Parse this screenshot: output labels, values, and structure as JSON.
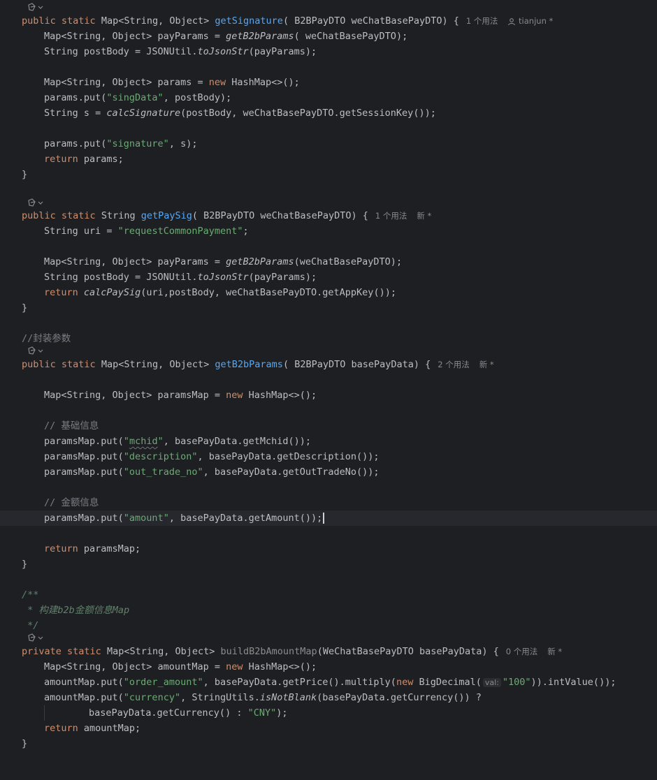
{
  "editor": {
    "methods": [
      {
        "signature": {
          "mods": "public static",
          "ret": "Map<String, Object>",
          "name": "getSignature",
          "params": "( B2BPayDTO weChatBasePayDTO) {"
        },
        "usages": "1 个用法",
        "author": "tianjun *"
      },
      {
        "signature": {
          "mods": "public static",
          "ret": "String",
          "name": "getPaySig",
          "params": "( B2BPayDTO weChatBasePayDTO) {"
        },
        "usages": "1 个用法",
        "author": "新 *"
      },
      {
        "comment": "//封装参数",
        "signature": {
          "mods": "public static",
          "ret": "Map<String, Object>",
          "name": "getB2bParams",
          "params": "( B2BPayDTO basePayData) {"
        },
        "usages": "2 个用法",
        "author": "新 *"
      },
      {
        "signature": {
          "mods": "private static",
          "ret": "Map<String, Object>",
          "name": "buildB2bAmountMap",
          "params": "(WeChatBasePayDTO basePayData) {"
        },
        "usages": "0 个用法",
        "author": "新 *"
      }
    ],
    "code": {
      "m1": {
        "l1": "Map<String, Object> payParams = ",
        "l1_call": "getB2bParams",
        "l1_end": "( weChatBasePayDTO);",
        "l2": "String postBody = JSONUtil.",
        "l2_call": "toJsonStr",
        "l2_end": "(payParams);",
        "l3": "Map<String, Object> params = ",
        "l3_kw": "new",
        "l3_end": " HashMap<>();",
        "l4": "params.put(",
        "l4_str": "\"singData\"",
        "l4_end": ", postBody);",
        "l5": "String s = ",
        "l5_call": "calcSignature",
        "l5_end": "(postBody, weChatBasePayDTO.getSessionKey());",
        "l6": "params.put(",
        "l6_str": "\"signature\"",
        "l6_end": ", s);",
        "l7_kw": "return",
        "l7_end": " params;",
        "close": "}"
      },
      "m2": {
        "l1": "String uri = ",
        "l1_str": "\"requestCommonPayment\"",
        "l1_end": ";",
        "l2": "Map<String, Object> payParams = ",
        "l2_call": "getB2bParams",
        "l2_end": "(weChatBasePayDTO);",
        "l3": "String postBody = JSONUtil.",
        "l3_call": "toJsonStr",
        "l3_end": "(payParams);",
        "l4_kw": "return",
        "l4_sp": " ",
        "l4_call": "calcPaySig",
        "l4_end": "(uri,postBody, weChatBasePayDTO.getAppKey());",
        "close": "}"
      },
      "m3": {
        "l1": "Map<String, Object> paramsMap = ",
        "l1_kw": "new",
        "l1_end": " HashMap<>();",
        "c1": "// 基础信息",
        "l2": "paramsMap.put(",
        "l2_q1": "\"",
        "l2_str": "mchid",
        "l2_q2": "\"",
        "l2_end": ", basePayData.getMchid());",
        "l3": "paramsMap.put(",
        "l3_str": "\"description\"",
        "l3_end": ", basePayData.getDescription());",
        "l4": "paramsMap.put(",
        "l4_str": "\"out_trade_no\"",
        "l4_end": ", basePayData.getOutTradeNo());",
        "c2": "// 金额信息",
        "l5": "paramsMap.put(",
        "l5_str": "\"amount\"",
        "l5_end": ", basePayData.getAmount());",
        "l6_kw": "return",
        "l6_end": " paramsMap;",
        "close": "}"
      },
      "m4": {
        "doc1": "/**",
        "doc2": " * 构建b2b金额信息Map",
        "doc3": " */",
        "l1": "Map<String, Object> amountMap = ",
        "l1_kw": "new",
        "l1_end": " HashMap<>();",
        "l2": "amountMap.put(",
        "l2_str": "\"order_amount\"",
        "l2_mid": ", basePayData.getPrice().multiply(",
        "l2_kw": "new",
        "l2_bd": " BigDecimal(",
        "l2_inlay": "val:",
        "l2_str2": "\"100\"",
        "l2_end": ")).intValue());",
        "l3": "amountMap.put(",
        "l3_str": "\"currency\"",
        "l3_mid": ", StringUtils.",
        "l3_call": "isNotBlank",
        "l3_end": "(basePayData.getCurrency()) ?",
        "l4": "basePayData.getCurrency() : ",
        "l4_str": "\"CNY\"",
        "l4_end": ");",
        "l5_kw": "return",
        "l5_end": " amountMap;",
        "close": "}"
      }
    },
    "colors": {
      "background": "#1e1f22",
      "keyword": "#cf8e6d",
      "function": "#56a8f5",
      "string": "#6aab73",
      "comment": "#7a7e85",
      "doc_comment": "#5f826b"
    }
  }
}
